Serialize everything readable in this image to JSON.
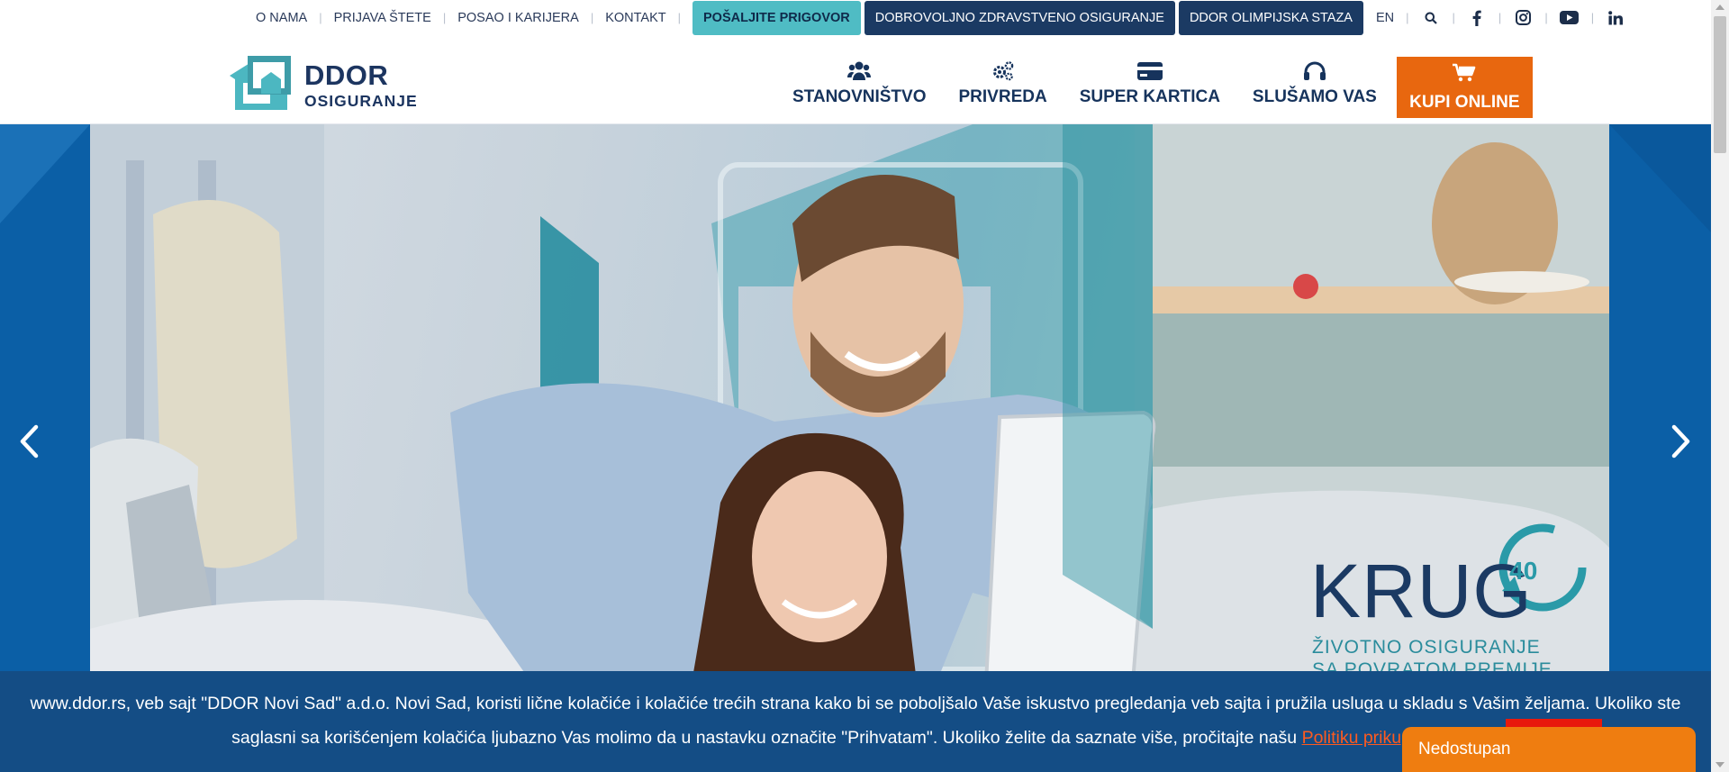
{
  "topbar": {
    "links": [
      "O NAMA",
      "PRIJAVA ŠTETE",
      "POSAO I KARIJERA",
      "KONTAKT"
    ],
    "pills": [
      "POŠALJITE PRIGOVOR",
      "DOBROVOLJNO ZDRAVSTVENO OSIGURANJE",
      "DDOR OLIMPIJSKA STAZA"
    ],
    "lang": "EN",
    "icons": [
      "search-icon",
      "facebook-icon",
      "instagram-icon",
      "youtube-icon",
      "linkedin-icon"
    ]
  },
  "logo": {
    "line1": "DDOR",
    "line2": "OSIGURANJE"
  },
  "nav": {
    "items": [
      {
        "label": "STANOVNIŠTVO",
        "icon": "users-icon"
      },
      {
        "label": "PRIVREDA",
        "icon": "gears-icon"
      },
      {
        "label": "SUPER KARTICA",
        "icon": "credit-card-icon"
      },
      {
        "label": "SLUŠAMO VAS",
        "icon": "headphones-icon"
      }
    ],
    "buy": {
      "label": "KUPI ONLINE",
      "icon": "cart-icon"
    }
  },
  "hero": {
    "brand": "KRUG",
    "brand_number": "40",
    "tagline_1": "ŽIVOTNO OSIGURANJE",
    "tagline_2": "SA POVRATOM PREMIJE",
    "prev_icon": "chevron-left-icon",
    "next_icon": "chevron-right-icon",
    "scroll_icon": "chevron-down-icon"
  },
  "cookie": {
    "text_1": "www.ddor.rs, veb sajt \"DDOR Novi Sad\" a.d.o. Novi Sad, koristi lične kolačiće i kolačiće trećih strana kako bi se poboljšalo Vaše iskustvo pregledanja veb sajta i pružila usluga u skladu s Vašim željama. Ukoliko ste saglasni sa korišćenjem kolačića ljubazno Vas molimo da u nastavku označite \"Prihvatam\". Ukoliko želite da saznate više, pročitajte našu",
    "link": "Politiku prikupljanja kol"
  },
  "chat": {
    "label": "Nedostupan"
  },
  "colors": {
    "navy": "#1b3a63",
    "teal": "#4fbcc4",
    "orange": "#e8670f",
    "hero_blue": "#0b5fa6",
    "cookie_bg": "#144d85",
    "cookie_link": "#ff5a1f",
    "accept_red": "#e8190c",
    "chat_orange": "#ef7d10"
  }
}
